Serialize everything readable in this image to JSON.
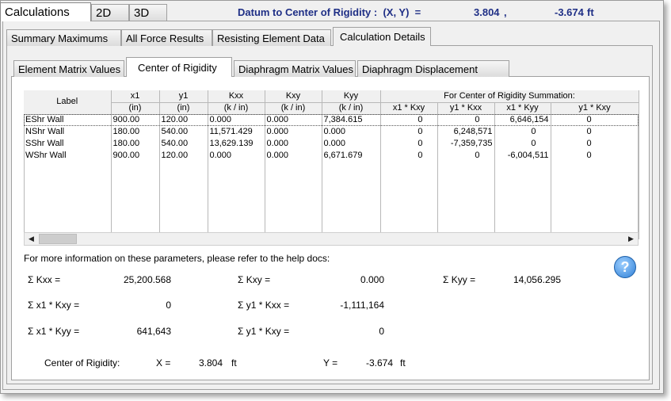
{
  "top_tabs": [
    {
      "label": "Calculations"
    },
    {
      "label": "2D"
    },
    {
      "label": "3D"
    }
  ],
  "header": {
    "label": "Datum to Center of Rigidity :  (X, Y)  =",
    "x": "3.804",
    "comma": ",",
    "y": "-3.674",
    "unit": "ft"
  },
  "tabs2": [
    {
      "label": "Summary Maximums"
    },
    {
      "label": "All Force Results"
    },
    {
      "label": "Resisting Element Data"
    },
    {
      "label": "Calculation Details"
    }
  ],
  "tabs3": [
    {
      "label": "Element Matrix Values"
    },
    {
      "label": "Center of Rigidity"
    },
    {
      "label": "Diaphragm Matrix Values"
    },
    {
      "label": "Diaphragm Displacement"
    }
  ],
  "grid": {
    "header_top": [
      "Label",
      "x1",
      "y1",
      "Kxx",
      "Kxy",
      "Kyy",
      "For Center of Rigidity Summation:"
    ],
    "header_units": [
      "(in)",
      "(in)",
      "(k / in)",
      "(k / in)",
      "(k / in)"
    ],
    "header_sum": [
      "x1 * Kxy",
      "y1 * Kxx",
      "x1 * Kyy",
      "y1 * Kxy"
    ],
    "rows": [
      [
        "EShr Wall",
        "900.00",
        "120.00",
        "0.000",
        "0.000",
        "7,384.615",
        "0",
        "0",
        "6,646,154",
        "0"
      ],
      [
        "NShr Wall",
        "180.00",
        "540.00",
        "11,571.429",
        "0.000",
        "0.000",
        "0",
        "6,248,571",
        "0",
        "0"
      ],
      [
        "SShr Wall",
        "180.00",
        "540.00",
        "13,629.139",
        "0.000",
        "0.000",
        "0",
        "-7,359,735",
        "0",
        "0"
      ],
      [
        "WShr Wall",
        "900.00",
        "120.00",
        "0.000",
        "0.000",
        "6,671.679",
        "0",
        "0",
        "-6,004,511",
        "0"
      ]
    ]
  },
  "info_text": "For more information on these parameters, please refer to the help docs:",
  "sums": {
    "kxx_label": "Σ  Kxx  =",
    "kxx_value": "25,200.568",
    "kxy_label": "Σ  Kxy  =",
    "kxy_value": "0.000",
    "kyy_label": "Σ  Kyy  =",
    "kyy_value": "14,056.295",
    "x1kxy_label": "Σ  x1 * Kxy  =",
    "x1kxy_value": "0",
    "y1kxx_label": "Σ  y1 * Kxx  =",
    "y1kxx_value": "-1,111,164",
    "x1kyy_label": "Σ  x1 * Kyy  =",
    "x1kyy_value": "641,643",
    "y1kxy_label": "Σ  y1 * Kxy  =",
    "y1kxy_value": "0"
  },
  "cor": {
    "label": "Center of Rigidity:",
    "x_label": "X  =",
    "x_value": "3.804",
    "x_unit": "ft",
    "y_label": "Y  =",
    "y_value": "-3.674",
    "y_unit": "ft"
  },
  "help_glyph": "?",
  "icons": {
    "help": "help-icon",
    "scroll_left": "arrow-left-icon",
    "scroll_right": "arrow-right-icon"
  },
  "scroll_left_glyph": "◀",
  "scroll_right_glyph": "▶"
}
